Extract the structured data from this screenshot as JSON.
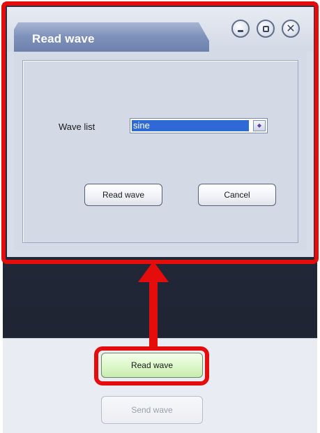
{
  "dialog": {
    "title": "Read wave",
    "window_controls": {
      "minimize_icon": "minimize-icon",
      "maximize_icon": "maximize-icon",
      "close_icon": "close-icon"
    },
    "wave_list": {
      "label": "Wave list",
      "selected": "sine"
    },
    "buttons": {
      "read_wave": "Read wave",
      "cancel": "Cancel"
    }
  },
  "main": {
    "buttons": {
      "read_wave": "Read wave",
      "send_wave": "Send wave"
    }
  },
  "colors": {
    "annotation_red": "#e50c0c",
    "selection_blue": "#2f69d8",
    "dark_bg": "#242a3a",
    "dialog_bg": "#d8dee9"
  }
}
